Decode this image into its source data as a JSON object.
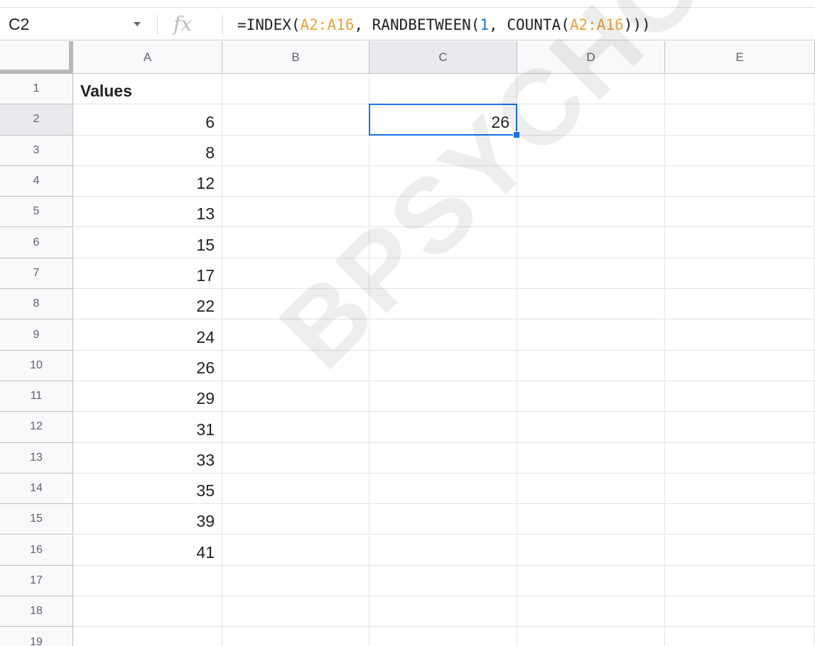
{
  "name_box": {
    "value": "C2"
  },
  "formula_bar": {
    "parts": [
      {
        "text": "=INDEX(",
        "kind": "plain"
      },
      {
        "text": "A2:A16",
        "kind": "ref"
      },
      {
        "text": ", RANDBETWEEN(",
        "kind": "plain"
      },
      {
        "text": "1",
        "kind": "num"
      },
      {
        "text": ", COUNTA(",
        "kind": "plain"
      },
      {
        "text": "A2:A16",
        "kind": "ref"
      },
      {
        "text": ")))",
        "kind": "plain"
      }
    ]
  },
  "columns": [
    "A",
    "B",
    "C",
    "D",
    "E"
  ],
  "rows": [
    "1",
    "2",
    "3",
    "4",
    "5",
    "6",
    "7",
    "8",
    "9",
    "10",
    "11",
    "12",
    "13",
    "14",
    "15",
    "16",
    "17",
    "18",
    "19"
  ],
  "cells": {
    "A1": "Values",
    "A2": "6",
    "A3": "8",
    "A4": "12",
    "A5": "13",
    "A6": "15",
    "A7": "17",
    "A8": "22",
    "A9": "24",
    "A10": "26",
    "A11": "29",
    "A12": "31",
    "A13": "33",
    "A14": "35",
    "A15": "39",
    "A16": "41",
    "C2": "26"
  },
  "selected_cell": "C2",
  "watermark": "BPSYCHOLOGY.COM",
  "colors": {
    "accent": "#1a73e8",
    "reference": "#e8a33c",
    "header_bg": "#f8f9fa",
    "gridline": "#e2e3e3"
  }
}
